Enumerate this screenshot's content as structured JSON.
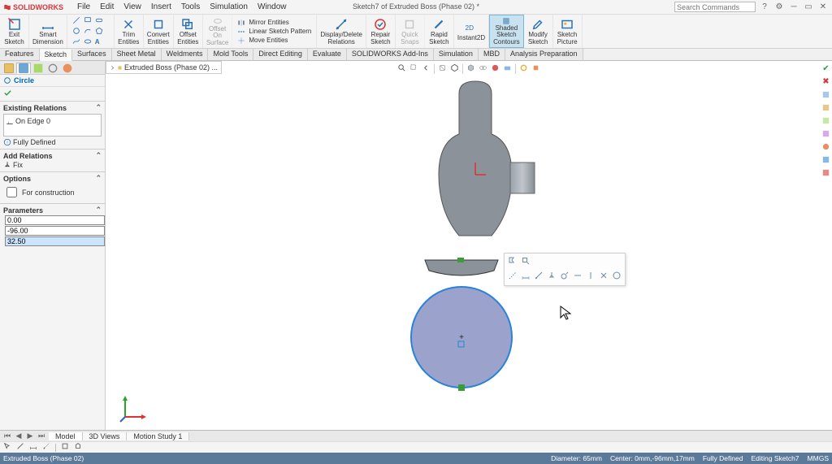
{
  "app": {
    "name": "SOLIDWORKS",
    "doc_title": "Sketch7 of Extruded Boss (Phase 02) *"
  },
  "menu": [
    "File",
    "Edit",
    "View",
    "Insert",
    "Tools",
    "Simulation",
    "Window"
  ],
  "search_placeholder": "Search Commands",
  "ribbon": {
    "exit_sketch": "Exit\nSketch",
    "smart_dim": "Smart\nDimension",
    "trim": "Trim\nEntities",
    "convert": "Convert\nEntities",
    "offset": "Offset\nEntities",
    "offset_surf": "Offset\nOn\nSurface",
    "mirror": "Mirror Entities",
    "linpat": "Linear Sketch Pattern",
    "move": "Move Entities",
    "disprel": "Display/Delete\nRelations",
    "repair": "Repair\nSketch",
    "quick": "Quick\nSnaps",
    "rapid": "Rapid\nSketch",
    "instant": "Instant2D",
    "shaded": "Shaded\nSketch\nContours",
    "modify": "Modify\nSketch",
    "picture": "Sketch\nPicture"
  },
  "tabs": [
    "Features",
    "Sketch",
    "Surfaces",
    "Sheet Metal",
    "Weldments",
    "Mold Tools",
    "Direct Editing",
    "Evaluate",
    "SOLIDWORKS Add-Ins",
    "Simulation",
    "MBD",
    "Analysis Preparation"
  ],
  "active_tab": 1,
  "flyout": "Extruded Boss (Phase 02) ...",
  "pm": {
    "title": "Circle",
    "existing_relations_h": "Existing Relations",
    "existing_relations_item": "On Edge 0",
    "defined": "Fully Defined",
    "add_relations_h": "Add Relations",
    "fix": "Fix",
    "options_h": "Options",
    "for_construction": "For construction",
    "parameters_h": "Parameters",
    "cx": "0.00",
    "cy": "-96.00",
    "radius": "32.50"
  },
  "bottom_tabs": [
    "Model",
    "3D Views",
    "Motion Study 1"
  ],
  "status": {
    "left": "Extruded Boss (Phase 02)",
    "diameter": "Diameter: 65mm",
    "center": "Center: 0mm,-96mm,17mm",
    "defined": "Fully Defined",
    "editing": "Editing Sketch7",
    "units": "MMGS"
  }
}
